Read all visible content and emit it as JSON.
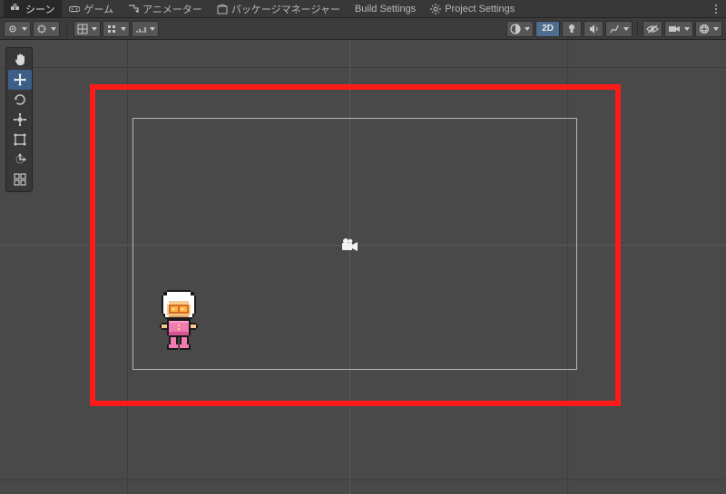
{
  "tabs": {
    "scene": "シーン",
    "game": "ゲーム",
    "animator": "アニメーター",
    "package_manager": "パッケージマネージャー",
    "build_settings": "Build Settings",
    "project_settings": "Project Settings"
  },
  "toolbar": {
    "mode_2d": "2D"
  },
  "colors": {
    "highlight_red": "#ff1a1a",
    "grid": "#3e3e3e",
    "axis": "#5a5a5a",
    "camera_frame": "#b7b7b7"
  },
  "tools": {
    "hand": "hand",
    "move": "move",
    "rotate": "rotate",
    "scale": "scale",
    "rect": "rect",
    "transform": "transform",
    "custom": "custom"
  }
}
